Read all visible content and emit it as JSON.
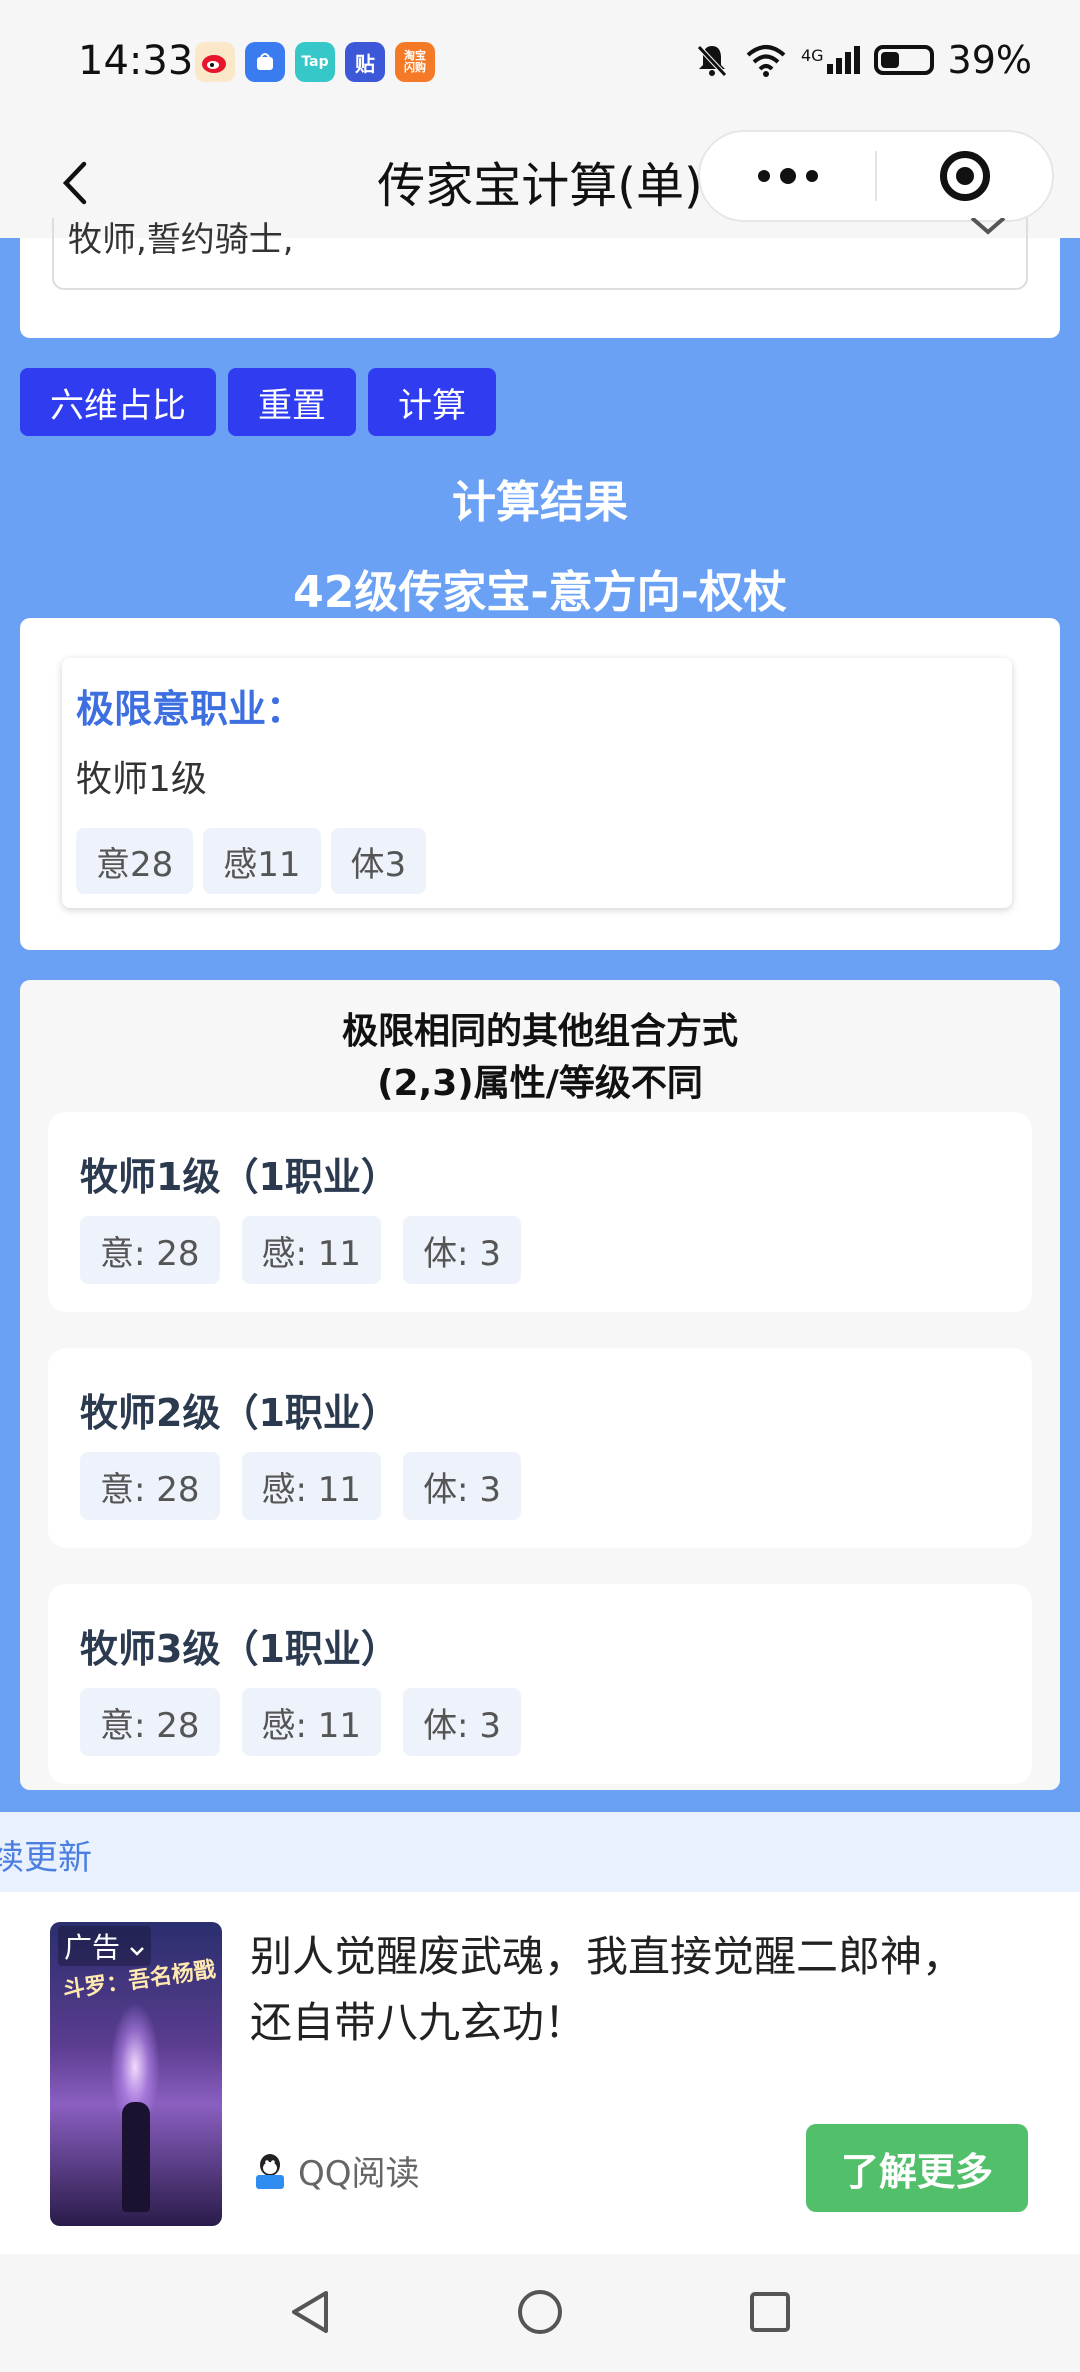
{
  "status_bar": {
    "time": "14:33",
    "apps": [
      {
        "name": "weibo-icon",
        "color": "#f5a623",
        "glyph": ""
      },
      {
        "name": "app-market-icon",
        "color": "#3b7bf0",
        "glyph": ""
      },
      {
        "name": "taptap-icon",
        "color": "#36c8c8",
        "glyph": "Tap"
      },
      {
        "name": "tieba-icon",
        "color": "#3c58d8",
        "glyph": "贴"
      },
      {
        "name": "taobao-flash-icon",
        "color": "#f57a27",
        "glyph": "淘宝\n闪购"
      }
    ],
    "network": "4G",
    "battery": "39%"
  },
  "nav": {
    "title": "传家宝计算(单)"
  },
  "select": {
    "value": "牧师,誓约骑士,"
  },
  "buttons": {
    "ratio": "六维占比",
    "reset": "重置",
    "calc": "计算"
  },
  "result": {
    "title": "计算结果",
    "subtitle": "42级传家宝-意方向-权杖"
  },
  "limit": {
    "label": "极限意职业：",
    "job": "牧师1级",
    "tags": [
      "意28",
      "感11",
      "体3"
    ]
  },
  "combos": {
    "heading_line1": "极限相同的其他组合方式",
    "heading_line2": "(2,3)属性/等级不同",
    "items": [
      {
        "name": "牧师1级（1职业）",
        "tags": [
          "意: 28",
          "感: 11",
          "体: 3"
        ]
      },
      {
        "name": "牧师2级（1职业）",
        "tags": [
          "意: 28",
          "感: 11",
          "体: 3"
        ]
      },
      {
        "name": "牧师3级（1职业）",
        "tags": [
          "意: 28",
          "感: 11",
          "体: 3"
        ]
      }
    ]
  },
  "ad": {
    "strip_text": "续更新",
    "badge": "广告",
    "cover_title": "斗罗：吾名杨戬",
    "text": "别人觉醒废武魂，我直接觉醒二郎神，还自带八九玄功！",
    "source": "QQ阅读",
    "cta": "了解更多"
  }
}
